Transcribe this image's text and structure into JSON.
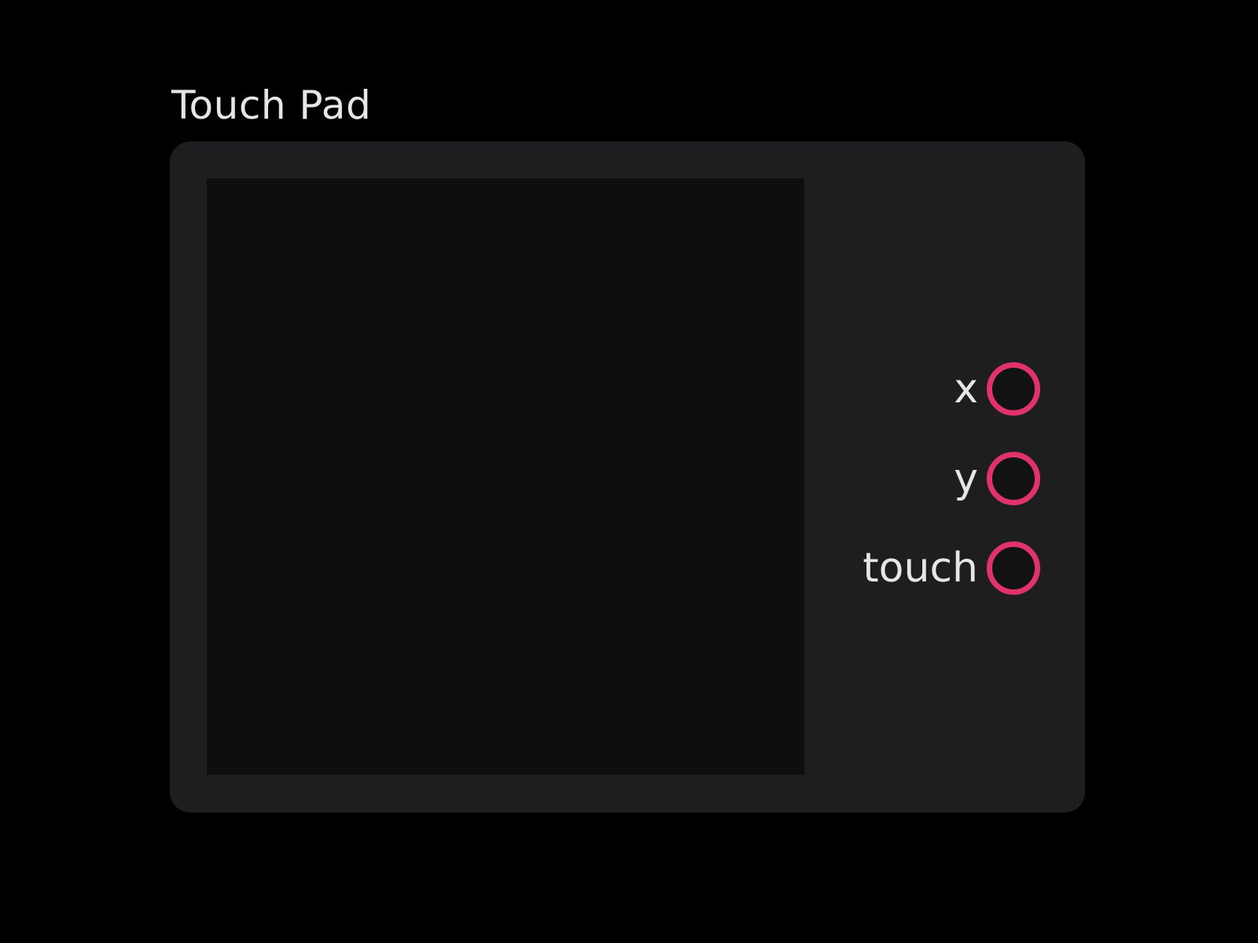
{
  "node": {
    "title": "Touch Pad",
    "outputs": [
      {
        "label": "x"
      },
      {
        "label": "y"
      },
      {
        "label": "touch"
      }
    ]
  },
  "colors": {
    "background": "#000000",
    "node_body": "#1e1e20",
    "touch_area": "#0e0e0e",
    "port_ring": "#e0336a",
    "text": "#e6e6e6"
  },
  "icons": {
    "output_port": "output-port-icon"
  }
}
